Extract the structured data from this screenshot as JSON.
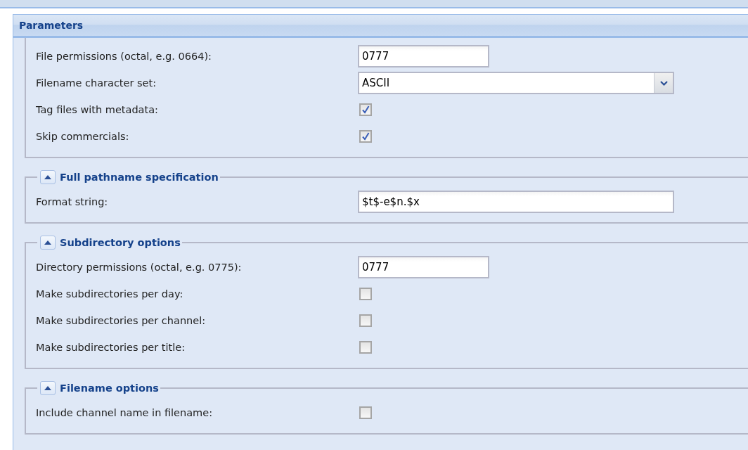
{
  "panel": {
    "title": "Parameters"
  },
  "sections": [
    {
      "rows": [
        {
          "kind": "short-text",
          "label": "File permissions (octal, e.g. 0664):",
          "value": "0777"
        },
        {
          "kind": "combo",
          "label": "Filename character set:",
          "value": "ASCII"
        },
        {
          "kind": "checkbox",
          "label": "Tag files with metadata:",
          "checked": true
        },
        {
          "kind": "checkbox",
          "label": "Skip commercials:",
          "checked": true
        }
      ]
    },
    {
      "title": "Full pathname specification",
      "expanded": true,
      "rows": [
        {
          "kind": "text",
          "label": "Format string:",
          "value": "$t$-e$n.$x"
        }
      ]
    },
    {
      "title": "Subdirectory options",
      "expanded": true,
      "rows": [
        {
          "kind": "short-text",
          "label": "Directory permissions (octal, e.g. 0775):",
          "value": "0777"
        },
        {
          "kind": "checkbox",
          "label": "Make subdirectories per day:",
          "checked": false
        },
        {
          "kind": "checkbox",
          "label": "Make subdirectories per channel:",
          "checked": false
        },
        {
          "kind": "checkbox",
          "label": "Make subdirectories per title:",
          "checked": false
        }
      ]
    },
    {
      "title": "Filename options",
      "expanded": true,
      "rows": [
        {
          "kind": "checkbox",
          "label": "Include channel name in filename:",
          "checked": false
        }
      ]
    }
  ]
}
